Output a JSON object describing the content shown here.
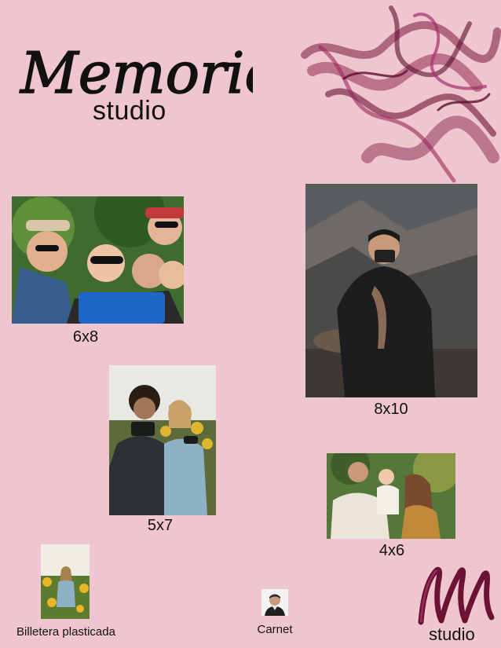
{
  "brand": {
    "name_script": "Memories",
    "name_sub": "studio",
    "corner_sub": "studio"
  },
  "colors": {
    "background": "#efc6cf",
    "ink": "#111111",
    "smoke": "#7a1740"
  },
  "sizes": [
    {
      "label": "6x8"
    },
    {
      "label": "8x10"
    },
    {
      "label": "5x7"
    },
    {
      "label": "4x6"
    },
    {
      "label": "Billetera plasticada"
    },
    {
      "label": "Carnet"
    }
  ]
}
